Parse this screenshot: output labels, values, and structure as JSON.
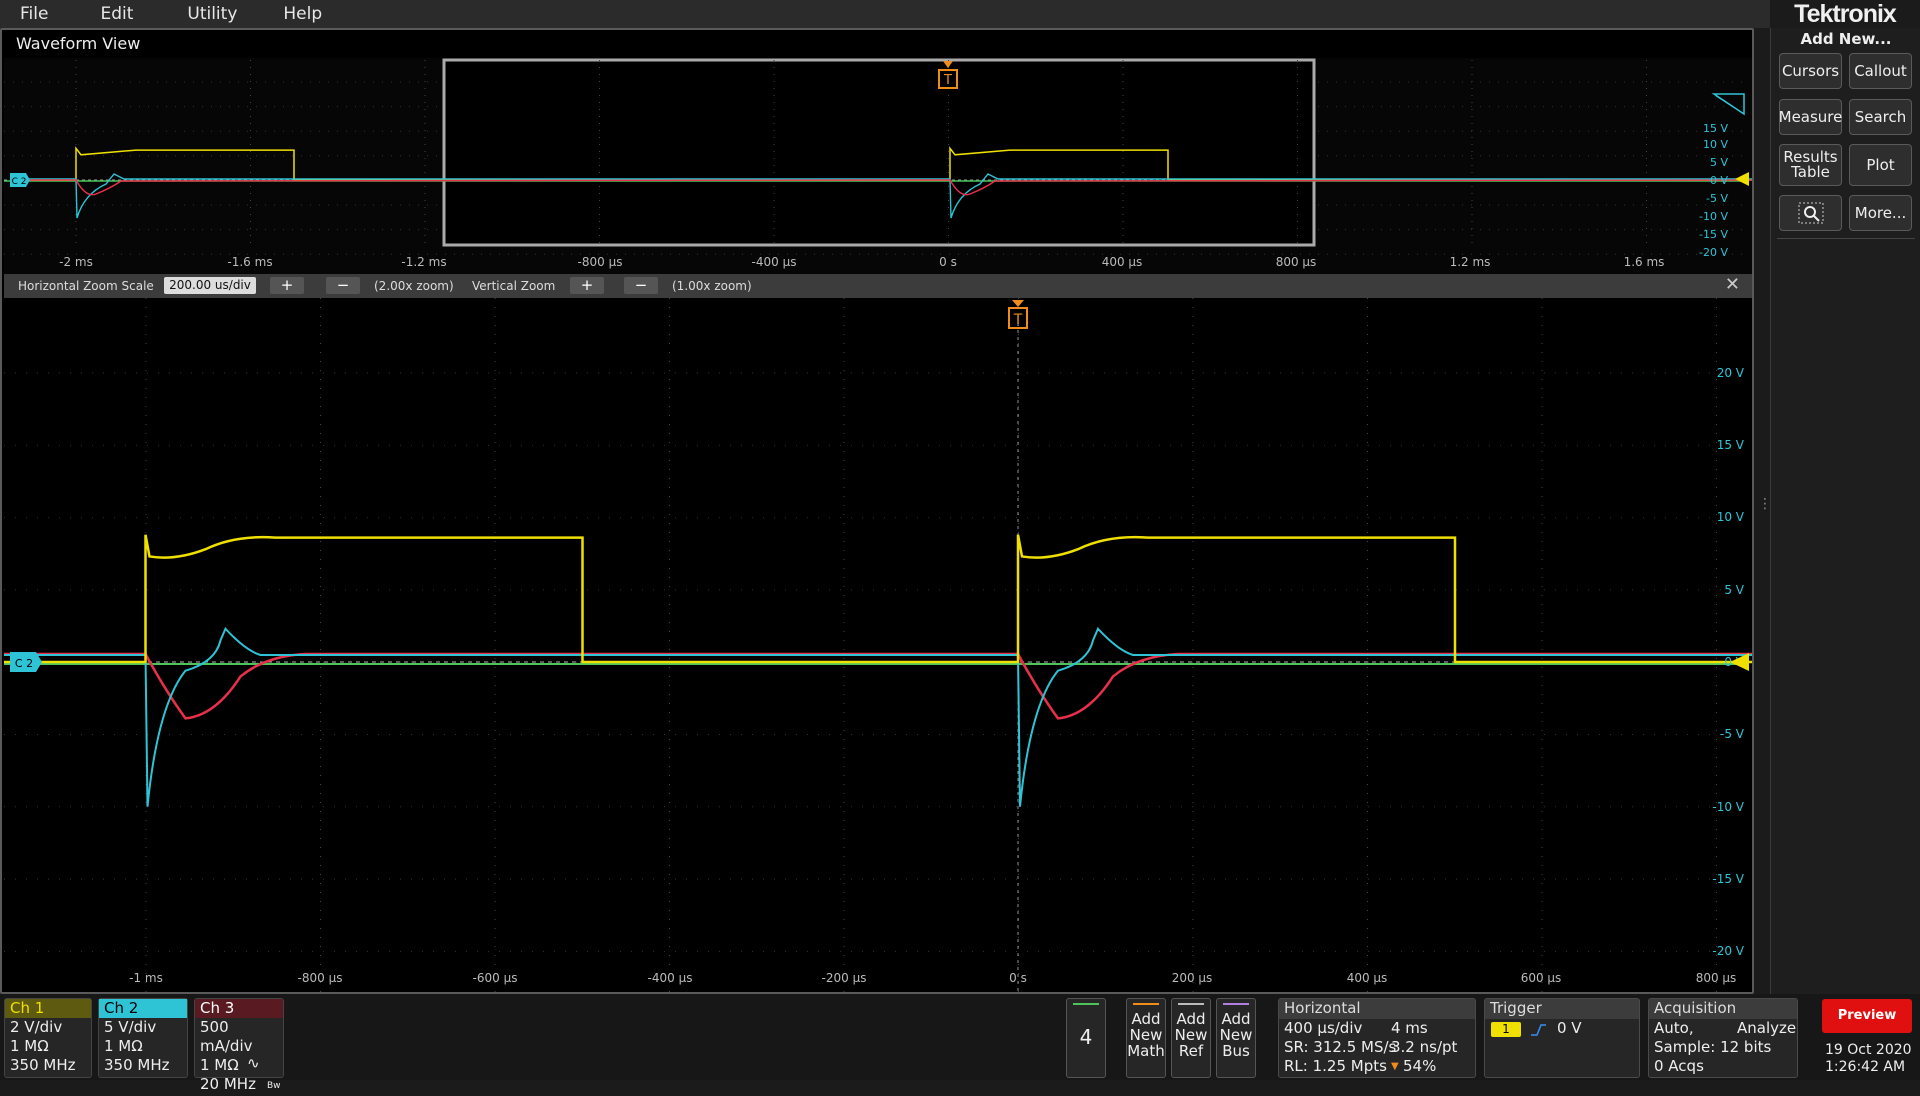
{
  "menu": [
    "File",
    "Edit",
    "Utility",
    "Help"
  ],
  "brand": "Tektronix",
  "window_title": "Waveform View",
  "right_panel": {
    "title": "Add New...",
    "buttons": [
      "Cursors",
      "Callout",
      "Measure",
      "Search",
      "Results Table",
      "Plot",
      "More..."
    ],
    "zoom_icon": "zoom-search-icon"
  },
  "overview": {
    "x_ticks": [
      "-2 ms",
      "-1.6 ms",
      "-1.2 ms",
      "-800 µs",
      "-400 µs",
      "0 s",
      "400 µs",
      "800 µs",
      "1.2 ms",
      "1.6 ms"
    ],
    "y_ticks": [
      "15 V",
      "10 V",
      "5 V",
      "0 V",
      "-5 V",
      "-10 V",
      "-15 V",
      "-20 V"
    ]
  },
  "zoom_bar": {
    "h_label": "Horizontal Zoom Scale",
    "h_value": "200.00 us/div",
    "h_zoom": "(2.00x zoom)",
    "v_label": "Vertical Zoom",
    "v_zoom": "(1.00x zoom)",
    "plus": "+",
    "minus": "−",
    "close": "✕"
  },
  "markers": {
    "trigger": "T",
    "channel_tag": "C 2"
  },
  "main": {
    "x_ticks": [
      "-1 ms",
      "-800 µs",
      "-600 µs",
      "-400 µs",
      "-200 µs",
      "0 s",
      "200 µs",
      "400 µs",
      "600 µs",
      "800 µs"
    ],
    "y_ticks": [
      "20 V",
      "15 V",
      "10 V",
      "5 V",
      "0 V",
      "-5 V",
      "-10 V",
      "-15 V",
      "-20 V"
    ]
  },
  "channels": [
    {
      "name": "Ch 1",
      "color": "#f0e000",
      "lines": [
        "2 V/div",
        "1 MΩ",
        "350 MHz"
      ]
    },
    {
      "name": "Ch 2",
      "color": "#2ec4d6",
      "lines": [
        "5 V/div",
        "1 MΩ",
        "350 MHz"
      ]
    },
    {
      "name": "Ch 3",
      "color": "#e8304a",
      "lines": [
        "500 mA/div",
        "1 MΩ",
        "20 MHz"
      ]
    }
  ],
  "ch3_icons": {
    "ac": "∿",
    "bw": "Bw"
  },
  "ch4_button": "4",
  "add_new": [
    "Add New Math",
    "Add New Ref",
    "Add New Bus"
  ],
  "horizontal": {
    "title": "Horizontal",
    "rows": [
      [
        "400 µs/div",
        "4 ms"
      ],
      [
        "SR: 312.5 MS/s",
        "3.2 ns/pt"
      ],
      [
        "RL: 1.25 Mpts",
        "54%"
      ]
    ]
  },
  "trigger": {
    "title": "Trigger",
    "source": "1",
    "level": "0 V"
  },
  "acquisition": {
    "title": "Acquisition",
    "rows": [
      "Auto,",
      "Analyze",
      "Sample: 12 bits",
      "0 Acqs"
    ]
  },
  "preview": "Preview",
  "date": "19 Oct 2020",
  "time": "1:26:42 AM",
  "colors": {
    "ch1": "#f0e000",
    "ch2": "#2ec4d6",
    "ch3": "#e8304a",
    "ch4": "#4cc45a",
    "trigger": "#f08c1a"
  }
}
